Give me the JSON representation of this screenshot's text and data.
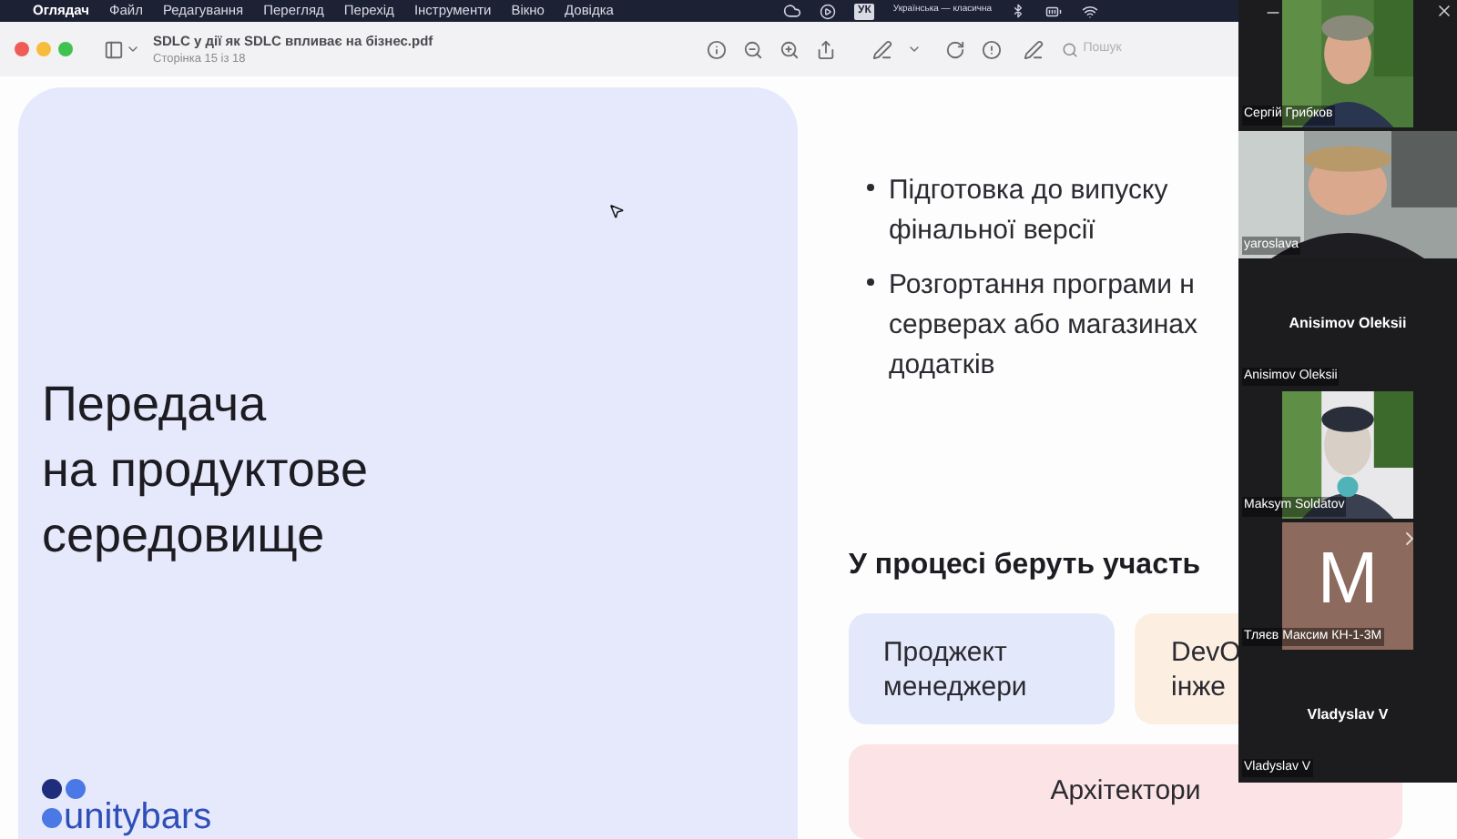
{
  "menu_bar": {
    "app_name": "Оглядач",
    "items": [
      "Файл",
      "Редагування",
      "Перегляд",
      "Перехід",
      "Інструменти",
      "Вікно",
      "Довідка"
    ],
    "keyboard_badge": "УК",
    "input_source": "Українська — класична"
  },
  "toolbar": {
    "title": "SDLC у дії як SDLC впливає на бізнес.pdf",
    "subtitle": "Сторінка 15 із 18",
    "search": {
      "placeholder": "Пошук"
    }
  },
  "slide": {
    "heading": "Передача\nна продуктове\nсередовище",
    "bullets": [
      "Підготовка до випуску\nфінальної версії",
      "Розгортання програми н\nсерверах або магазинах\nдодатків"
    ],
    "participants_title": "У процесі беруть участь",
    "roles": [
      {
        "label": "Проджект\nменеджери",
        "color": "#e4e8fb"
      },
      {
        "label": "DevO\nінже",
        "color": "#fcefe2"
      },
      {
        "label": "Архітектори",
        "color": "#fbe3e6"
      }
    ],
    "logo": "unitybars"
  },
  "participants": [
    {
      "name": "Сергій Грибков",
      "kind": "video"
    },
    {
      "name": "yaroslava",
      "kind": "video"
    },
    {
      "name": "Anisimov Oleksii",
      "kind": "name",
      "caption": "Anisimov Oleksii"
    },
    {
      "name": "Maksym Soldatov",
      "kind": "video"
    },
    {
      "name": "Тляєв Максим КН-1-3М",
      "kind": "initial",
      "initial": "M",
      "color": "#8c6a5d"
    },
    {
      "name": "Vladyslav V",
      "kind": "name",
      "caption": "Vladyslav V"
    }
  ]
}
